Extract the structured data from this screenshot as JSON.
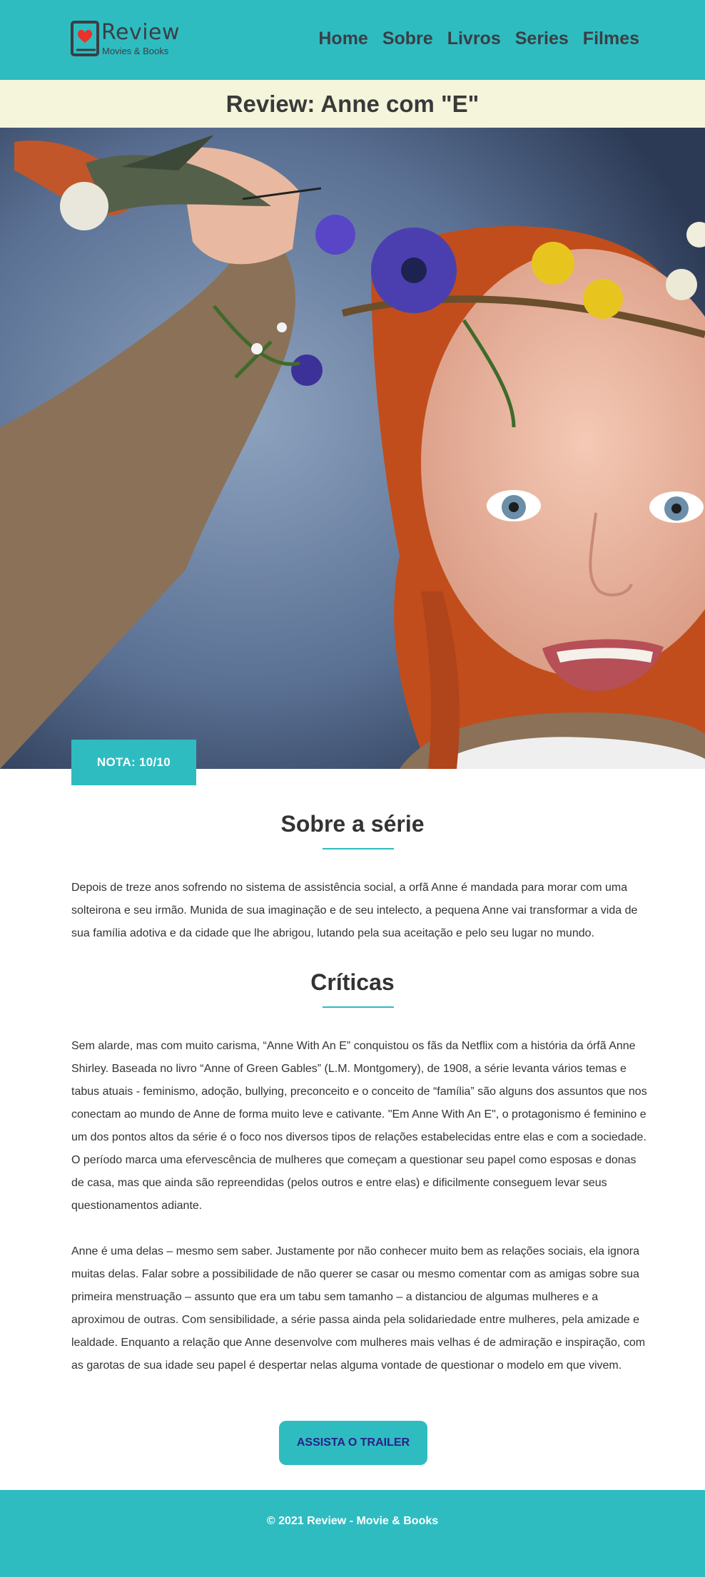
{
  "header": {
    "logo_title": "Review",
    "logo_subtitle": "Movies & Books",
    "nav": [
      "Home",
      "Sobre",
      "Livros",
      "Series",
      "Filmes"
    ]
  },
  "page": {
    "title": "Review: Anne com \"E\""
  },
  "rating": {
    "label": "NOTA: 10/10"
  },
  "about": {
    "heading": "Sobre a série",
    "text": "Depois de treze anos sofrendo no sistema de assistência social, a orfã Anne é mandada para morar com uma solteirona e seu irmão. Munida de sua imaginação e de seu intelecto, a pequena Anne vai transformar a vida de sua família adotiva e da cidade que lhe abrigou, lutando pela sua aceitação e pelo seu lugar no mundo."
  },
  "reviews": {
    "heading": "Críticas",
    "paragraph1": "Sem alarde, mas com muito carisma, “Anne With An E” conquistou os fãs da Netflix com a história da órfã Anne Shirley. Baseada no livro “Anne of Green Gables” (L.M. Montgomery), de 1908, a série levanta vários temas e tabus atuais - feminismo, adoção, bullying, preconceito e o conceito de “família” são alguns dos assuntos que nos conectam ao mundo de Anne de forma muito leve e cativante. \"Em Anne With An E\", o protagonismo é feminino e um dos pontos altos da série é o foco nos diversos tipos de relações estabelecidas entre elas e com a sociedade. O período marca uma efervescência de mulheres que começam a questionar seu papel como esposas e donas de casa, mas que ainda são repreendidas (pelos outros e entre elas) e dificilmente conseguem levar seus questionamentos adiante.",
    "paragraph2": "Anne é uma delas – mesmo sem saber. Justamente por não conhecer muito bem as relações sociais, ela ignora muitas delas. Falar sobre a possibilidade de não querer se casar ou mesmo comentar com as amigas sobre sua primeira menstruação – assunto que era um tabu sem tamanho – a distanciou de algumas mulheres e a aproximou de outras. Com sensibilidade, a série passa ainda pela solidariedade entre mulheres, pela amizade e lealdade. Enquanto a relação que Anne desenvolve com mulheres mais velhas é de admiração e inspiração, com as garotas de sua idade seu papel é despertar nelas alguma vontade de questionar o modelo em que vivem."
  },
  "cta": {
    "trailer_label": "ASSISTA O TRAILER"
  },
  "footer": {
    "text": "© 2021 Review - Movie & Books"
  },
  "colors": {
    "brand": "#2ebcc1",
    "title_band": "#f5f5dc",
    "cta_text": "#2b1f88",
    "text": "#333333"
  },
  "icons": {
    "logo": "book-heart-icon"
  }
}
